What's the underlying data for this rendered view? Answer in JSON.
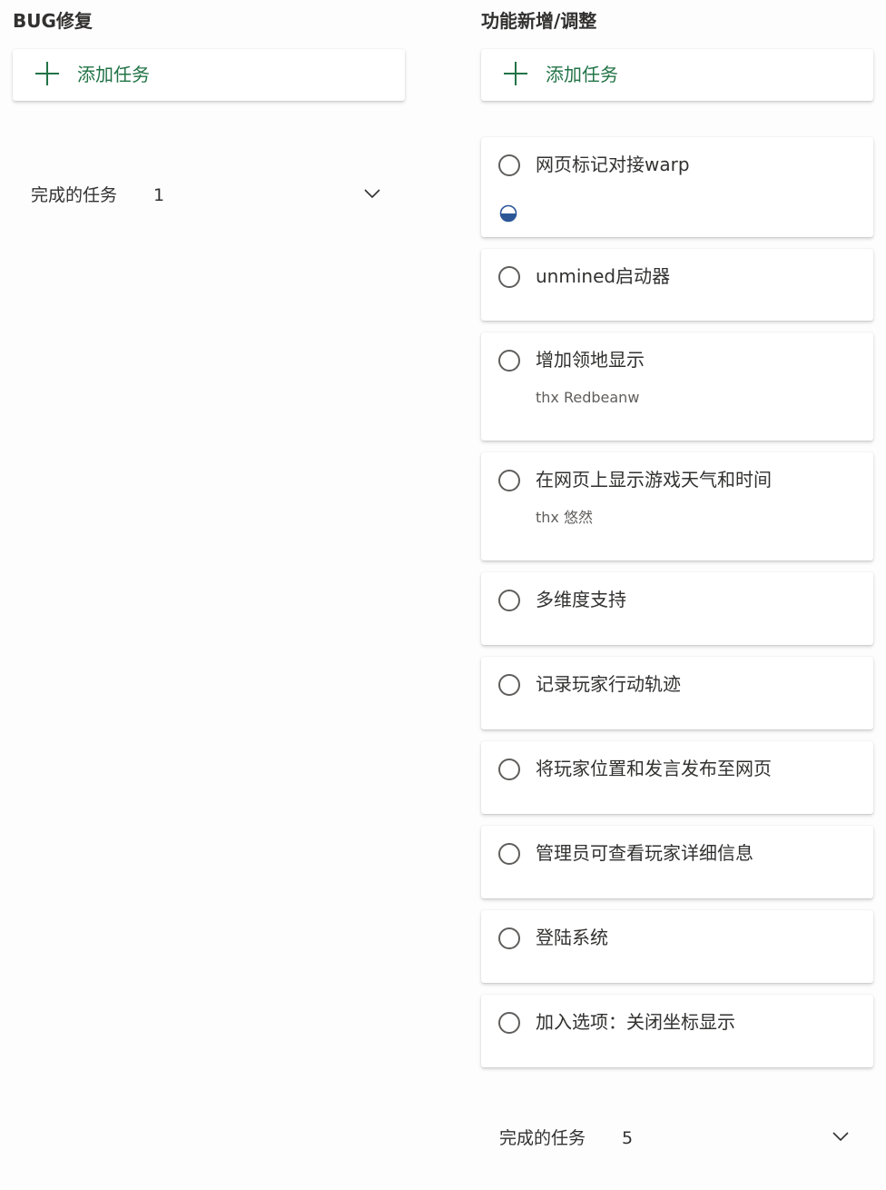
{
  "columns": {
    "bug": {
      "title": "BUG修复",
      "add_label": "添加任务",
      "completed_label": "完成的任务",
      "completed_count": "1"
    },
    "features": {
      "title": "功能新增/调整",
      "add_label": "添加任务",
      "completed_label": "完成的任务",
      "completed_count": "5",
      "tasks": [
        {
          "title": "网页标记对接warp",
          "progress": "in-progress"
        },
        {
          "title": "unmined启动器"
        },
        {
          "title": "增加领地显示",
          "note": "thx Redbeanw"
        },
        {
          "title": "在网页上显示游戏天气和时间",
          "note": "thx 悠然"
        },
        {
          "title": "多维度支持"
        },
        {
          "title": "记录玩家行动轨迹"
        },
        {
          "title": "将玩家位置和发言发布至网页"
        },
        {
          "title": "管理员可查看玩家详细信息"
        },
        {
          "title": "登陆系统"
        },
        {
          "title": "加入选项：关闭坐标显示"
        }
      ]
    }
  },
  "colors": {
    "accent": "#217346",
    "progress": "#2b5797"
  },
  "icons": {
    "add": "plus-icon",
    "expand": "chevron-down-icon",
    "complete": "circle-checkbox-icon",
    "progress": "half-circle-progress-icon"
  }
}
